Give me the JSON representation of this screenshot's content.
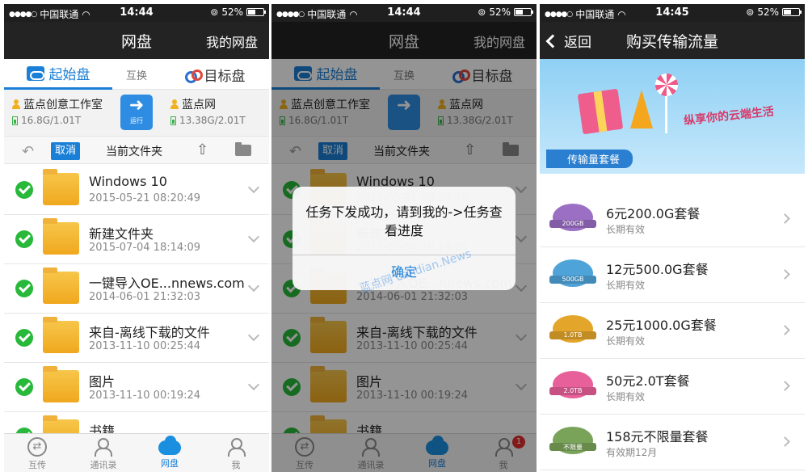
{
  "status": {
    "carrier": "中国联通",
    "battery": "52%",
    "battery_level": 0.52,
    "time1": "14:44",
    "time2": "14:44",
    "time3": "14:45"
  },
  "screen1": {
    "nav_title": "网盘",
    "nav_right": "我的网盘",
    "tabs": {
      "source": "起始盘",
      "swap": "互换",
      "target": "目标盘"
    },
    "source_disk": {
      "name": "蓝点创意工作室",
      "size": "16.8G/1.01T"
    },
    "target_disk": {
      "name": "蓝点网",
      "size": "13.38G/2.01T"
    },
    "run_label": "运行",
    "toolbar": {
      "cancel": "取消",
      "current_folder": "当前文件夹"
    },
    "files": [
      {
        "name": "Windows 10",
        "date": "2015-05-21 08:20:49"
      },
      {
        "name": "新建文件夹",
        "date": "2015-07-04 18:14:09"
      },
      {
        "name": "一键导入OE...nnews.com",
        "date": "2014-06-01 21:32:03"
      },
      {
        "name": "来自-离线下载的文件",
        "date": "2013-11-10 00:25:44"
      },
      {
        "name": "图片",
        "date": "2013-11-10 00:19:24"
      },
      {
        "name": "书籍",
        "date": ""
      }
    ],
    "bottom": {
      "transfer": "互传",
      "contacts": "通讯录",
      "netdisk": "网盘",
      "me": "我"
    }
  },
  "screen2": {
    "alert_message": "任务下发成功，请到我的->任务查看进度",
    "alert_button": "确定",
    "watermark": "蓝点网 Landian.News",
    "badge_count": "1"
  },
  "screen3": {
    "back_label": "返回",
    "nav_title": "购买传输流量",
    "banner_slogan": "纵享你的云端生活",
    "banner_label": "传输量套餐",
    "packages": [
      {
        "title": "6元200.0G套餐",
        "sub": "长期有效",
        "medal": "200GB",
        "color": "#9a6fc4"
      },
      {
        "title": "12元500.0G套餐",
        "sub": "长期有效",
        "medal": "500GB",
        "color": "#4ea3d9"
      },
      {
        "title": "25元1000.0G套餐",
        "sub": "长期有效",
        "medal": "1.0TB",
        "color": "#e3a52a"
      },
      {
        "title": "50元2.0T套餐",
        "sub": "长期有效",
        "medal": "2.0TB",
        "color": "#e8609a"
      },
      {
        "title": "158元不限量套餐",
        "sub": "有效期12月",
        "medal": "不限量",
        "color": "#7aa35a"
      }
    ]
  }
}
